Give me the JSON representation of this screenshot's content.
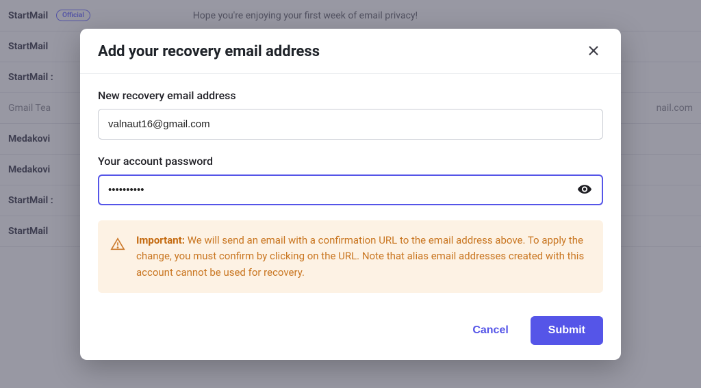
{
  "background": {
    "rows": [
      {
        "sender": "StartMail",
        "badge": "Official",
        "subject": "Hope you're enjoying your first week of email privacy!",
        "right": ""
      },
      {
        "sender": "StartMail",
        "badge": "",
        "subject": "",
        "right": ""
      },
      {
        "sender": "StartMail :",
        "badge": "",
        "subject": "",
        "right": ""
      },
      {
        "sender": "Gmail Tea",
        "badge": "",
        "subject": "",
        "right": "nail.com",
        "light": true
      },
      {
        "sender": "Medakovi",
        "badge": "",
        "subject": "",
        "right": ""
      },
      {
        "sender": "Medakovi",
        "badge": "",
        "subject": "",
        "right": ""
      },
      {
        "sender": "StartMail :",
        "badge": "",
        "subject": "",
        "right": ""
      },
      {
        "sender": "StartMail",
        "badge": "",
        "subject": "",
        "right": ""
      }
    ]
  },
  "modal": {
    "title": "Add your recovery email address",
    "email_label": "New recovery email address",
    "email_value": "valnaut16@gmail.com",
    "password_label": "Your account password",
    "password_value": "••••••••••",
    "alert_prefix": "Important:",
    "alert_body": " We will send an email with a confirmation URL to the email address above. To apply the change, you must confirm by clicking on the URL. Note that alias email addresses created with this account cannot be used for recovery.",
    "cancel_label": "Cancel",
    "submit_label": "Submit"
  }
}
